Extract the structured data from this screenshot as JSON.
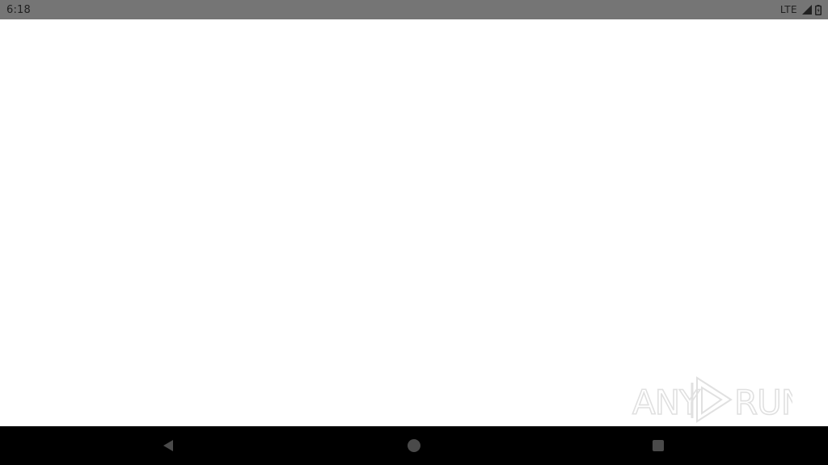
{
  "status_bar": {
    "time": "6:18",
    "network_label": "LTE",
    "signal_icon": "signal-icon",
    "battery_icon": "battery-icon"
  },
  "watermark": {
    "text_left": "ANY",
    "text_right": "RUN",
    "icon": "play-logo-icon"
  },
  "nav_bar": {
    "back_icon": "back-icon",
    "home_icon": "home-icon",
    "recents_icon": "recents-icon",
    "icon_color": "#4a4a4a"
  }
}
